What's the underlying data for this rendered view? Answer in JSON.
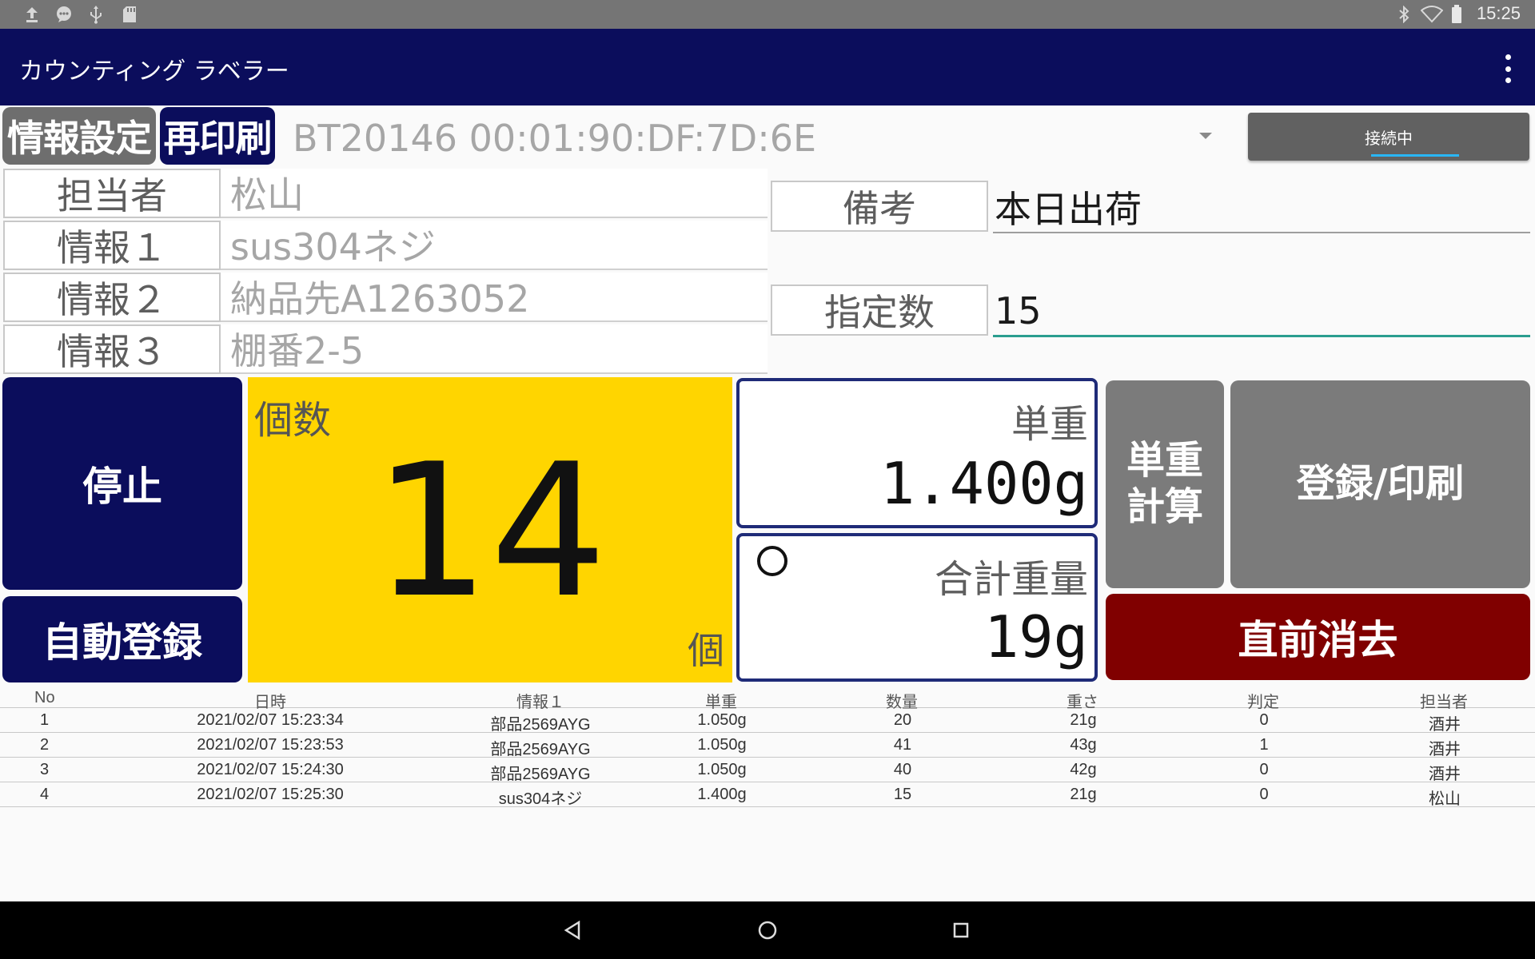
{
  "status_bar": {
    "left_icons": [
      "upload-icon",
      "chat-icon",
      "usb-icon",
      "sd-card-icon"
    ],
    "right_icons": [
      "bluetooth-icon",
      "wifi-icon",
      "battery-icon"
    ],
    "time": "15:25"
  },
  "app_bar": {
    "title": "カウンティング ラベラー",
    "menu_icon": "more-vert-icon"
  },
  "toolbar": {
    "info_settings_label": "情報設定",
    "reprint_label": "再印刷",
    "device_value": "BT20146 00:01:90:DF:7D:6E",
    "connect_label": "接続中"
  },
  "info": {
    "operator_label": "担当者",
    "operator_value": "松山",
    "info1_label": "情報１",
    "info1_value": "sus304ネジ",
    "info2_label": "情報２",
    "info2_value": "納品先A1263052",
    "info3_label": "情報３",
    "info3_value": "棚番2-5",
    "remark_label": "備考",
    "remark_value": "本日出荷",
    "target_label": "指定数",
    "target_value": "15"
  },
  "actions": {
    "stop_label": "停止",
    "auto_register_label": "自動登録",
    "count_caption": "個数",
    "count_value": "14",
    "count_unit": "個",
    "unit_weight_caption": "単重",
    "unit_weight_value": "1.400g",
    "total_weight_caption": "合計重量",
    "total_weight_value": "19g",
    "unit_calc_label_line1": "単重",
    "unit_calc_label_line2": "計算",
    "register_print_label": "登録/印刷",
    "undo_label": "直前消去"
  },
  "table": {
    "headers": [
      "No",
      "日時",
      "情報１",
      "単重",
      "数量",
      "重さ",
      "判定",
      "担当者"
    ],
    "rows": [
      [
        "1",
        "2021/02/07 15:23:34",
        "部品2569AYG",
        "1.050g",
        "20",
        "21g",
        "0",
        "酒井"
      ],
      [
        "2",
        "2021/02/07 15:23:53",
        "部品2569AYG",
        "1.050g",
        "41",
        "43g",
        "1",
        "酒井"
      ],
      [
        "3",
        "2021/02/07 15:24:30",
        "部品2569AYG",
        "1.050g",
        "40",
        "42g",
        "0",
        "酒井"
      ],
      [
        "4",
        "2021/02/07 15:25:30",
        "sus304ネジ",
        "1.400g",
        "15",
        "21g",
        "0",
        "松山"
      ]
    ]
  },
  "nav_bar": {
    "icons": [
      "back-icon",
      "home-icon",
      "recents-icon"
    ]
  }
}
